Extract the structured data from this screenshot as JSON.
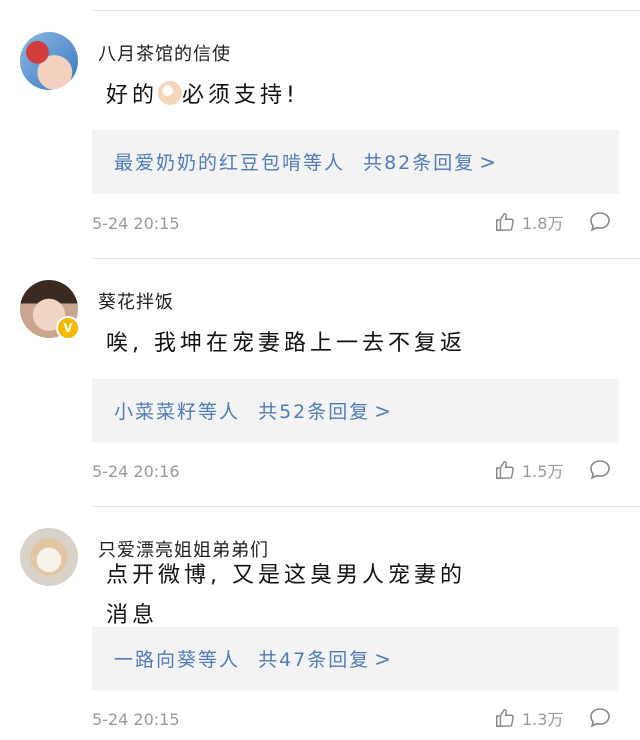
{
  "comments": [
    {
      "username": "八月茶馆的信使",
      "text_before_emoji": "好的",
      "emoji": "ok-hand",
      "text_after_emoji": "必须支持!",
      "replies": {
        "who": "最爱奶奶的红豆包啃等人",
        "count": "共82条回复"
      },
      "time": "5-24 20:15",
      "likes": "1.8万"
    },
    {
      "username": "葵花拌饭",
      "verified": true,
      "text": "唉, 我坤在宠妻路上一去不复返",
      "replies": {
        "who": "小菜菜籽等人",
        "count": "共52条回复"
      },
      "time": "5-24 20:16",
      "likes": "1.5万"
    },
    {
      "username": "只爱漂亮姐姐弟弟们",
      "text_line1": "点开微博, 又是这臭男人宠妻的",
      "text_line2": "消息",
      "replies": {
        "who": "一路向葵等人",
        "count": "共47条回复"
      },
      "time": "5-24 20:15",
      "likes": "1.3万"
    }
  ],
  "colors": {
    "link": "#4f7cbb",
    "reply_bg": "#f3f3f3",
    "meta": "#999999"
  }
}
